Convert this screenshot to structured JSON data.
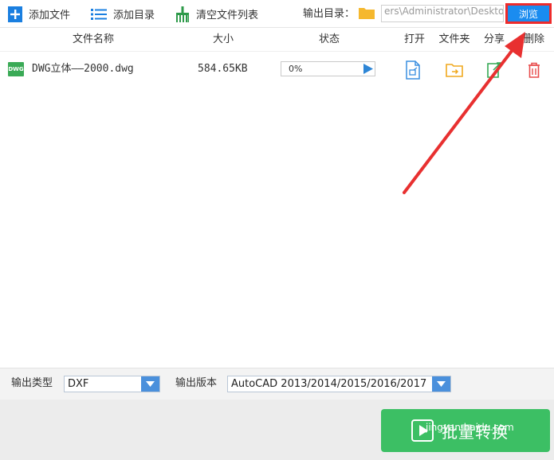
{
  "toolbar": {
    "add_file": "添加文件",
    "add_dir": "添加目录",
    "clear_list": "清空文件列表",
    "output_dir_label": "输出目录：",
    "output_path": "ers\\Administrator\\Desktop",
    "browse": "浏览"
  },
  "list_header": {
    "name": "文件名称",
    "size": "大小",
    "status": "状态",
    "open": "打开",
    "folder": "文件夹",
    "share": "分享",
    "delete": "删除"
  },
  "files": [
    {
      "icon_text": "DWG",
      "name": "DWG立体——2000.dwg",
      "size": "584.65KB",
      "progress_label": "0%",
      "progress": 0
    }
  ],
  "bottom": {
    "type_label": "输出类型",
    "type_value": "DXF",
    "version_label": "输出版本",
    "version_value": "AutoCAD 2013/2014/2015/2016/2017"
  },
  "footer": {
    "convert": "批量转换",
    "watermark": "jingyan.baidu.com"
  },
  "colors": {
    "accent": "#1a8cf0",
    "highlight_box": "#ee2b2b",
    "convert_green": "#3cbf64",
    "annotation_arrow": "#e83030"
  },
  "icons": [
    "plus-file-icon",
    "list-icon",
    "broom-icon",
    "folder-icon",
    "play-icon",
    "open-doc-icon",
    "open-folder-icon",
    "share-icon",
    "trash-icon",
    "dropdown-arrow-icon",
    "convert-play-icon"
  ]
}
